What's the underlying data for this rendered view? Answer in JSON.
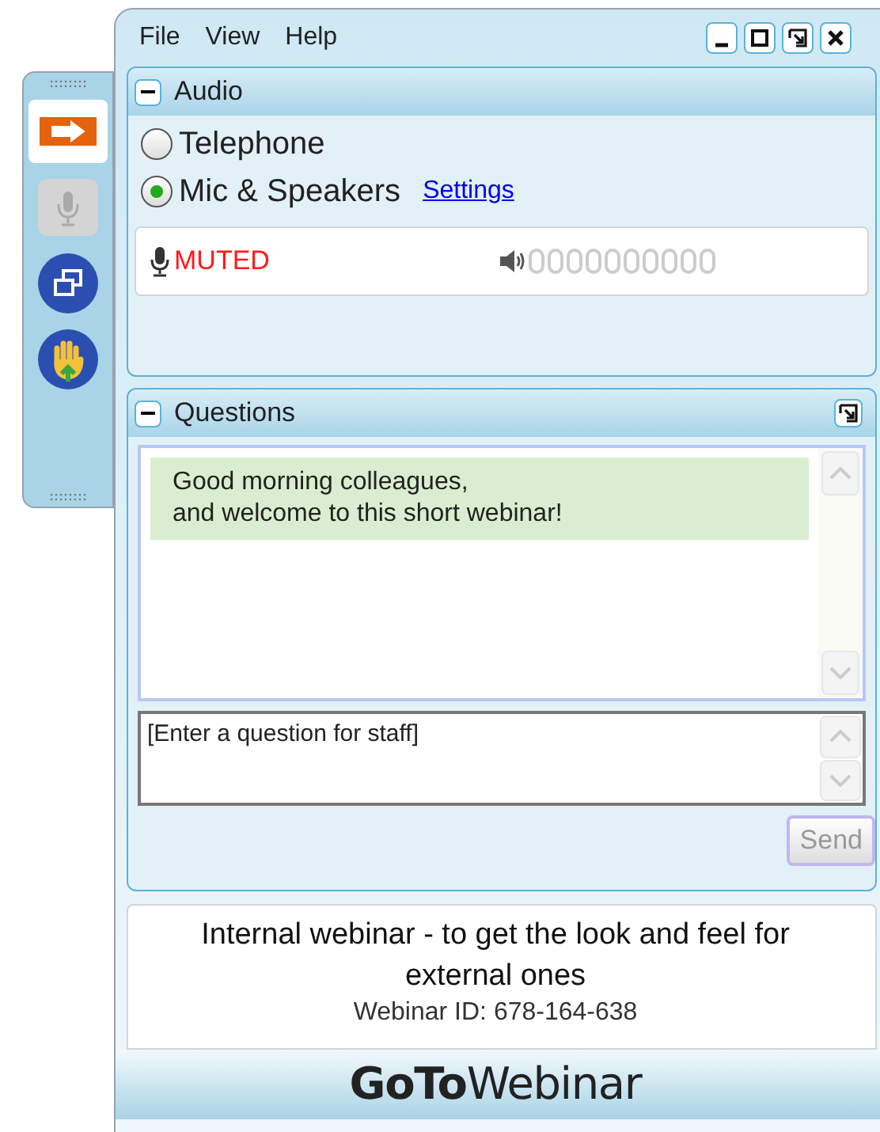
{
  "toolbar": {
    "buttons": [
      {
        "kind": "arrow",
        "selected": true,
        "disabled": false
      },
      {
        "kind": "mic",
        "selected": false,
        "disabled": true
      },
      {
        "kind": "restore",
        "selected": false,
        "disabled": false
      },
      {
        "kind": "hand",
        "selected": false,
        "disabled": false
      }
    ]
  },
  "menu": [
    "File",
    "View",
    "Help"
  ],
  "window_buttons": [
    {
      "kind": "minimize"
    },
    {
      "kind": "maximize"
    },
    {
      "kind": "restore"
    },
    {
      "kind": "close"
    }
  ],
  "audio": {
    "title": "Audio",
    "options": [
      {
        "label": "Telephone",
        "selected": false
      },
      {
        "label": "Mic & Speakers",
        "selected": true
      }
    ],
    "settings_link": "Settings",
    "mic_status": "MUTED"
  },
  "questions": {
    "title": "Questions",
    "messages": [
      {
        "text": "Good morning colleagues,\nand welcome to this short webinar!"
      }
    ],
    "input": {
      "placeholder": "[Enter a question for staff]"
    },
    "send_button": {
      "label": "Send",
      "disabled": true
    }
  },
  "info": {
    "title": "Internal webinar - to get the look and feel for external ones",
    "webinar_id": "Webinar ID: 678-164-638"
  },
  "logo": "**GoTo**Webinar"
}
